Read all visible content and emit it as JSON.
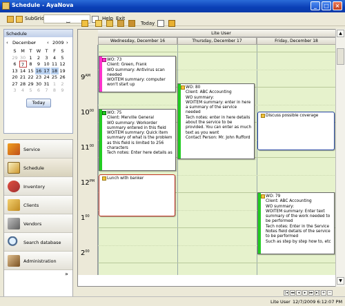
{
  "window": {
    "title": "Schedule - AyaNova",
    "min": "_",
    "max": "□",
    "close": "×"
  },
  "menubar": {
    "subgrids_label": "SubGrids",
    "help_label": "Help",
    "exit_label": "Exit"
  },
  "calendar": {
    "header": "Schedule",
    "month": "December",
    "year": "2009",
    "weekdays": [
      "S",
      "M",
      "T",
      "W",
      "T",
      "F",
      "S"
    ],
    "weeks": [
      [
        "29",
        "30",
        "1",
        "2",
        "3",
        "4",
        "5"
      ],
      [
        "6",
        "7",
        "8",
        "9",
        "10",
        "11",
        "12"
      ],
      [
        "13",
        "14",
        "15",
        "16",
        "17",
        "18",
        "19"
      ],
      [
        "20",
        "21",
        "22",
        "23",
        "24",
        "25",
        "26"
      ],
      [
        "27",
        "28",
        "29",
        "30",
        "31",
        "1",
        "2"
      ],
      [
        "3",
        "4",
        "5",
        "6",
        "7",
        "8",
        "9"
      ]
    ],
    "today_button": "Today"
  },
  "nav": {
    "items": [
      {
        "label": "Service"
      },
      {
        "label": "Schedule"
      },
      {
        "label": "Inventory"
      },
      {
        "label": "Clients"
      },
      {
        "label": "Vendors"
      },
      {
        "label": "Search database"
      },
      {
        "label": "Administration"
      }
    ],
    "more": "»"
  },
  "toolbar": {
    "today_label": "Today"
  },
  "schedule": {
    "user": "Lite User",
    "days": [
      "Wednesday, December 16",
      "Thursday, December 17",
      "Friday, December 18"
    ],
    "hours": [
      {
        "num": "9",
        "sup": "AM"
      },
      {
        "num": "10",
        "sup": "00"
      },
      {
        "num": "11",
        "sup": "00"
      },
      {
        "num": "12",
        "sup": "PM"
      },
      {
        "num": "1",
        "sup": "00"
      },
      {
        "num": "2",
        "sup": "00"
      }
    ],
    "appointments": [
      {
        "text": "WO: 73\nClient:  Green, Frank\nWO summary: Antivirus scan needed\nWOITEM summary: computer won't start up",
        "color": "#ff33cc"
      },
      {
        "text": "WO: 75\nClient:  Merville General\nWO summary: Workorder summary entered in this field\nWOITEM summary: Quick item summary of what is the problem as this field is limited to 256 characters\nTech notes: Enter here details as",
        "color": "#22cc22"
      },
      {
        "text": "Lunch with banker",
        "color": "#ffffff"
      },
      {
        "text": "WO: 80\nClient:  ABC Accounting\nWO summary:\nWOITEM summary: enter in here a summary of the service needed\nTech notes: enter in here details about the service to be provided. You can enter as much text as you want\nContact Person:  Mr. John Rufford",
        "color": "#22cc22"
      },
      {
        "text": "Discuss possible coverage",
        "color": "#ffffff"
      },
      {
        "text": "WO: 79\nClient:  ABC Accounting\nWO summary:\nWOITEM summary: Enter text summary of the work needed to be performed\nTech notes: Enter in the Service Notes field details of the service to be performed\nSuch as step by step how to, etc",
        "color": "#22cc22"
      }
    ]
  },
  "status": {
    "user": "Lite User",
    "datetime": "12/7/2009 6:12:07 PM"
  },
  "icons": {
    "app": "app-icon",
    "calendar": "calendar-icon"
  }
}
